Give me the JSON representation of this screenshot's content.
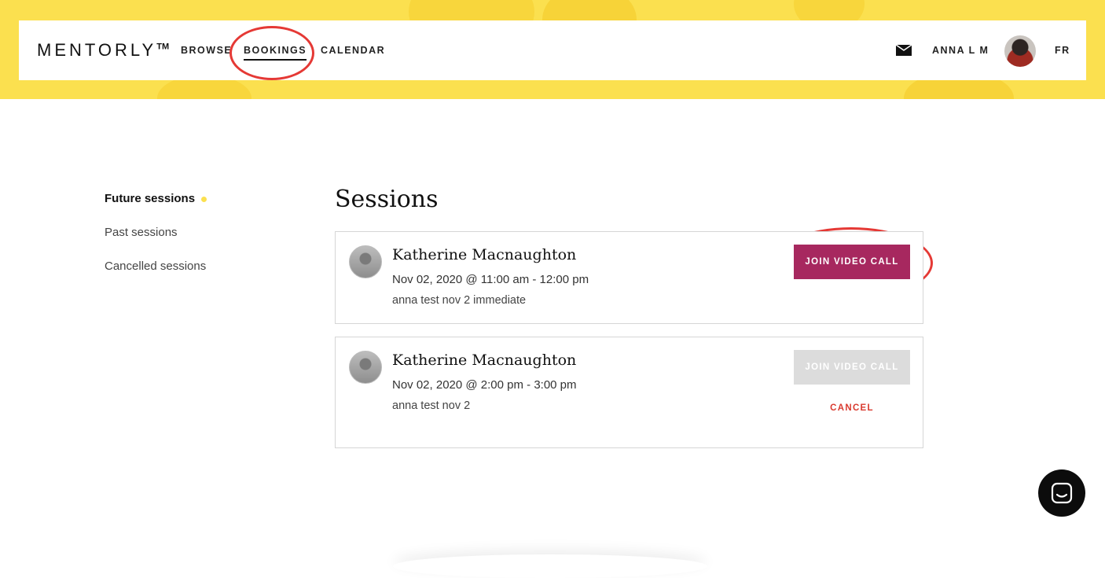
{
  "header": {
    "logo": "MENTORLY",
    "logo_mark": "TM",
    "nav": [
      {
        "label": "BROWSE"
      },
      {
        "label": "BOOKINGS",
        "active": true
      },
      {
        "label": "CALENDAR"
      }
    ],
    "user_name": "ANNA L M",
    "language": "FR"
  },
  "sidebar": {
    "items": [
      {
        "label": "Future sessions",
        "active": true
      },
      {
        "label": "Past sessions"
      },
      {
        "label": "Cancelled sessions"
      }
    ]
  },
  "main": {
    "title": "Sessions",
    "sessions": [
      {
        "mentor": "Katherine Macnaughton",
        "datetime": "Nov 02, 2020 @ 11:00 am - 12:00 pm",
        "description": "anna test nov 2 immediate",
        "join_label": "JOIN VIDEO CALL",
        "join_enabled": true
      },
      {
        "mentor": "Katherine Macnaughton",
        "datetime": "Nov 02, 2020 @ 2:00 pm - 3:00 pm",
        "description": "anna test nov 2",
        "join_label": "JOIN VIDEO CALL",
        "join_enabled": false,
        "cancel_label": "CANCEL"
      }
    ]
  },
  "colors": {
    "brand_yellow": "#fbe04f",
    "join_button": "#a7285f",
    "cancel": "#d93a2f",
    "annotation_circle": "#e53935"
  },
  "icons": [
    "mail-icon",
    "chat-icon"
  ]
}
